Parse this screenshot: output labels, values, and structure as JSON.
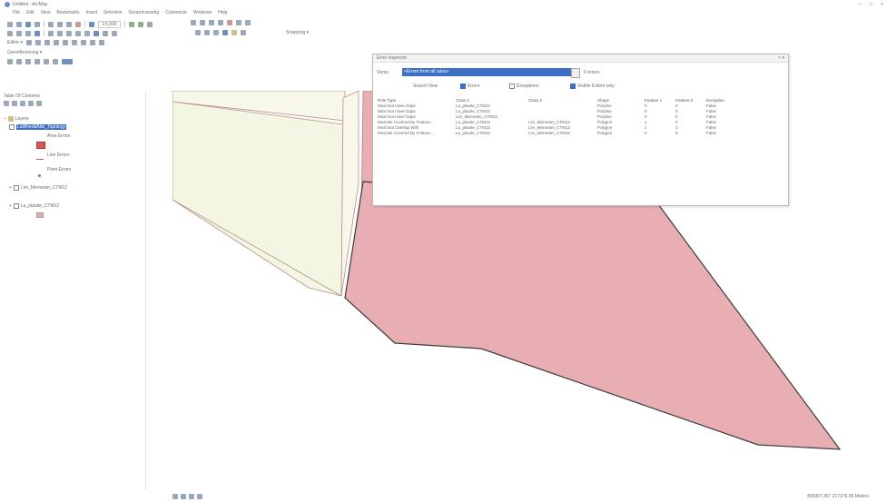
{
  "window": {
    "title": "Untitled - ArcMap",
    "controls": [
      "–",
      "□",
      "×"
    ]
  },
  "menu": [
    "File",
    "Edit",
    "View",
    "Bookmarks",
    "Insert",
    "Selection",
    "Geoprocessing",
    "Customize",
    "Windows",
    "Help"
  ],
  "toolbars": {
    "editor_label": "Editor ▾",
    "georef_label": "Georeferencing ▾",
    "snapping_label": "Snapping ▾",
    "scale_value": "1:5,000"
  },
  "toc": {
    "title": "Table Of Contents",
    "layers_label": "Layers",
    "topology_layer": "LaWheddAbe_Topology",
    "area_errors": "Area Errors",
    "line_errors": "Line Errors",
    "point_errors": "Point Errors",
    "layer_lim": "Lim_Merneam_CTM12",
    "layer_parcels": "La_plauite_CTM12"
  },
  "dialog": {
    "title": "Error Inspector",
    "show_label": "Show:",
    "show_value": "<Errors from all rules>",
    "count_label": "0 errors",
    "search_now": "Search Now",
    "errors_label": "Errors",
    "exceptions_label": "Exceptions",
    "visible_extent_label": "Visible Extent only",
    "columns": [
      "Rule Type",
      "Class 1",
      "Class 2",
      "Shape",
      "Feature 1",
      "Feature 2",
      "Exception"
    ],
    "rows": [
      [
        "Must Not Have Gaps",
        "La_plauite_CTM12",
        "",
        "Polyline",
        "0",
        "0",
        "False"
      ],
      [
        "Must Not Have Gaps",
        "La_plauite_CTM12",
        "",
        "Polyline",
        "0",
        "0",
        "False"
      ],
      [
        "Must Not Have Gaps",
        "Lim_Merneam_CTM12",
        "",
        "Polyline",
        "0",
        "0",
        "False"
      ],
      [
        "Must Be Covered By Feature...",
        "La_plauite_CTM12",
        "Lim_Merneam_CTM12",
        "Polygon",
        "1",
        "0",
        "False"
      ],
      [
        "Must Not Overlap With",
        "La_plauite_CTM12",
        "Lim_Merneam_CTM12",
        "Polygon",
        "1",
        "2",
        "False"
      ],
      [
        "Must Be Covered By Feature...",
        "La_plauite_CTM12",
        "Lim_Merneam_CTM12",
        "Polygon",
        "2",
        "0",
        "False"
      ]
    ]
  },
  "status": {
    "coords": "409907.357 217376.99 Meters"
  },
  "colors": {
    "parcel_fill": "#e9aeb3",
    "parcel_edge": "#3b3b3b",
    "neighbor_fill": "#f7f8ea",
    "selection": "#3a6fc4"
  }
}
